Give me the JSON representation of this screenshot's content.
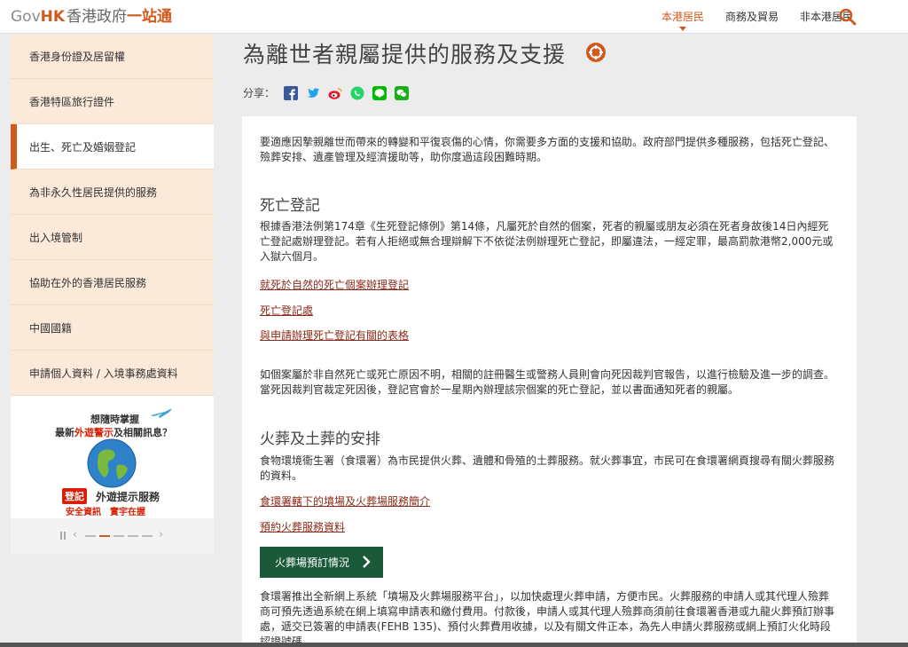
{
  "header": {
    "logo_gov": "Gov",
    "logo_hk": "HK",
    "logo_cn1": "香港政府",
    "logo_cn2": "一站通",
    "nav": [
      {
        "label": "本港居民",
        "active": true
      },
      {
        "label": "商務及貿易",
        "active": false
      },
      {
        "label": "非本港居民",
        "active": false
      }
    ],
    "search_icon": "search-icon"
  },
  "sidebar": {
    "items": [
      {
        "label": "香港身份證及居留權",
        "active": false
      },
      {
        "label": "香港特區旅行證件",
        "active": false
      },
      {
        "label": "出生、死亡及婚姻登記",
        "active": true
      },
      {
        "label": "為非永久性居民提供的服務",
        "active": false
      },
      {
        "label": "出入境管制",
        "active": false
      },
      {
        "label": "協助在外的香港居民服務",
        "active": false
      },
      {
        "label": "中國國籍",
        "active": false
      },
      {
        "label": "申請個人資料 / 入境事務處資料",
        "active": false
      }
    ]
  },
  "banner": {
    "line1": "想隨時掌握",
    "line2_a": "最新",
    "line2_red": "外遊警示",
    "line2_b": "及相關訊息？",
    "badge": "登記",
    "service": "外遊提示服務",
    "tagline": "安全資訊　實宇在握"
  },
  "main": {
    "title": "為離世者親屬提供的服務及支援",
    "share_label": "分享：",
    "share_icons": [
      "facebook-icon",
      "twitter-icon",
      "weibo-icon",
      "whatsapp-icon",
      "line-icon",
      "wechat-icon"
    ],
    "intro": "要適應因摯親離世而帶來的轉變和平復哀傷的心情，你需要多方面的支援和協助。政府部門提供多種服務，包括死亡登記、殮葬安排、遺產管理及經濟援助等，助你度過這段困難時期。",
    "sec1_title": "死亡登記",
    "sec1_para": "根據香港法例第174章《生死登記條例》第14條，凡屬死於自然的個案，死者的親屬或朋友必須在死者身故後14日內經死亡登記處辦理登記。若有人拒絕或無合理辯解下不依從法例辦理死亡登記，即屬違法，一經定罪，最高罰款港幣2,000元或入獄六個月。",
    "sec1_links": [
      "就死於自然的死亡個案辦理登記",
      "死亡登記處",
      "與申請辦理死亡登記有關的表格"
    ],
    "sec1_para2": "如個案屬於非自然死亡或死亡原因不明，相關的註冊醫生或警務人員則會向死因裁判官報告，以進行檢驗及進一步的調查。當死因裁判官裁定死因後，登記官會於一星期內辦理該宗個案的死亡登記，並以書面通知死者的親屬。",
    "sec2_title": "火葬及土葬的安排",
    "sec2_para": "食物環境衞生署（食環署）為市民提供火葬、遺體和骨殖的土葬服務。就火葬事宜，市民可在食環署網頁搜尋有關火葬服務的資料。",
    "sec2_links": [
      "食環署轄下的墳場及火葬場服務簡介",
      "預約火葬服務資料"
    ],
    "button_label": "火葬場預訂情況",
    "sec2_para2": "食環署推出全新網上系統「墳場及火葬場服務平台」，以加快處理火葬申請，方便市民。火葬服務的申請人或其代理人殮葬商可預先透過系統在網上填寫申請表和繳付費用。付款後，申請人或其代理人殮葬商須前往食環署香港或九龍火葬預訂辦事處，遞交已簽署的申請表(FEHB 135)、預付火葬費用收據，以及有關文件正本，為先人申請火葬服務或網上預訂火化時段認證號碼。"
  },
  "colors": {
    "accent": "#d05a1c",
    "sidebar_bg": "#fbe9da",
    "link": "#8b2b1a",
    "button": "#1a5a38"
  }
}
